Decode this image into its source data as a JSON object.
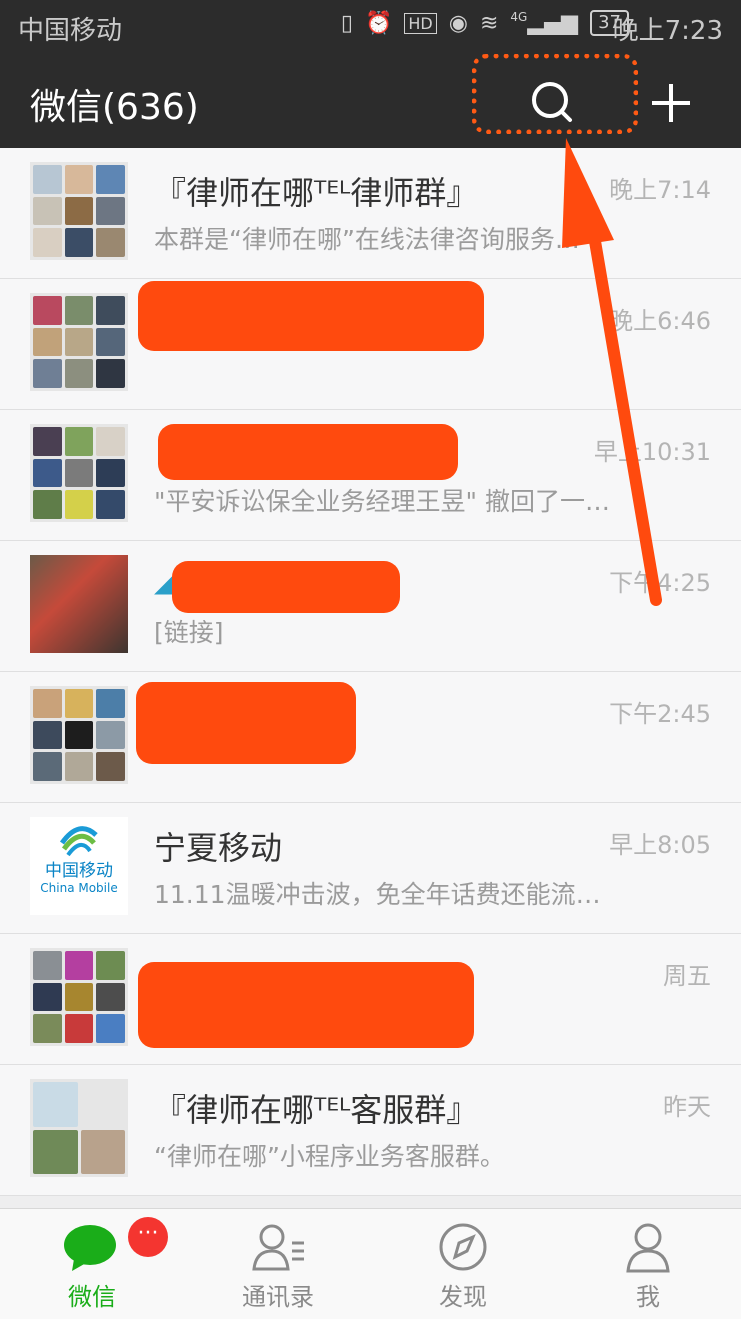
{
  "status_bar": {
    "carrier": "中国移动",
    "network": "4G",
    "battery": "37",
    "time": "晚上7:23"
  },
  "header": {
    "title": "微信(636)"
  },
  "chats": [
    {
      "name": "『律师在哪ᵀᴱᴸ律师群』",
      "preview": "本群是“律师在哪”在线法律咨询服务…",
      "time": "晚上7:14"
    },
    {
      "name": "",
      "preview": "",
      "time": "晚上6:46"
    },
    {
      "name": "",
      "preview": "\"平安诉讼保全业务经理王昱\" 撤回了一…",
      "time": "早上10:31"
    },
    {
      "name": "",
      "preview": "[链接]",
      "time": "下午4:25"
    },
    {
      "name": "",
      "preview": "",
      "time": "下午2:45"
    },
    {
      "name": "宁夏移动",
      "preview": "11.11温暖冲击波，免全年话费还能流…",
      "time": "早上8:05",
      "avatar_text": "中国移动",
      "avatar_subtext": "China Mobile"
    },
    {
      "name": "",
      "preview": "",
      "time": "周五"
    },
    {
      "name": "『律师在哪ᵀᴱᴸ客服群』",
      "preview": "“律师在哪”小程序业务客服群。",
      "time": "昨天"
    }
  ],
  "bottom_nav": {
    "tabs": [
      {
        "label": "微信",
        "active": true,
        "badge": "···"
      },
      {
        "label": "通讯录"
      },
      {
        "label": "发现"
      },
      {
        "label": "我"
      }
    ]
  },
  "colors": {
    "header_bg": "#2c2c2c",
    "accent_green": "#1aad19",
    "annotation_orange": "#ff4a0e"
  },
  "icons": [
    "search-icon",
    "plus-icon",
    "chat-icon",
    "contacts-icon",
    "discover-icon",
    "me-icon"
  ]
}
